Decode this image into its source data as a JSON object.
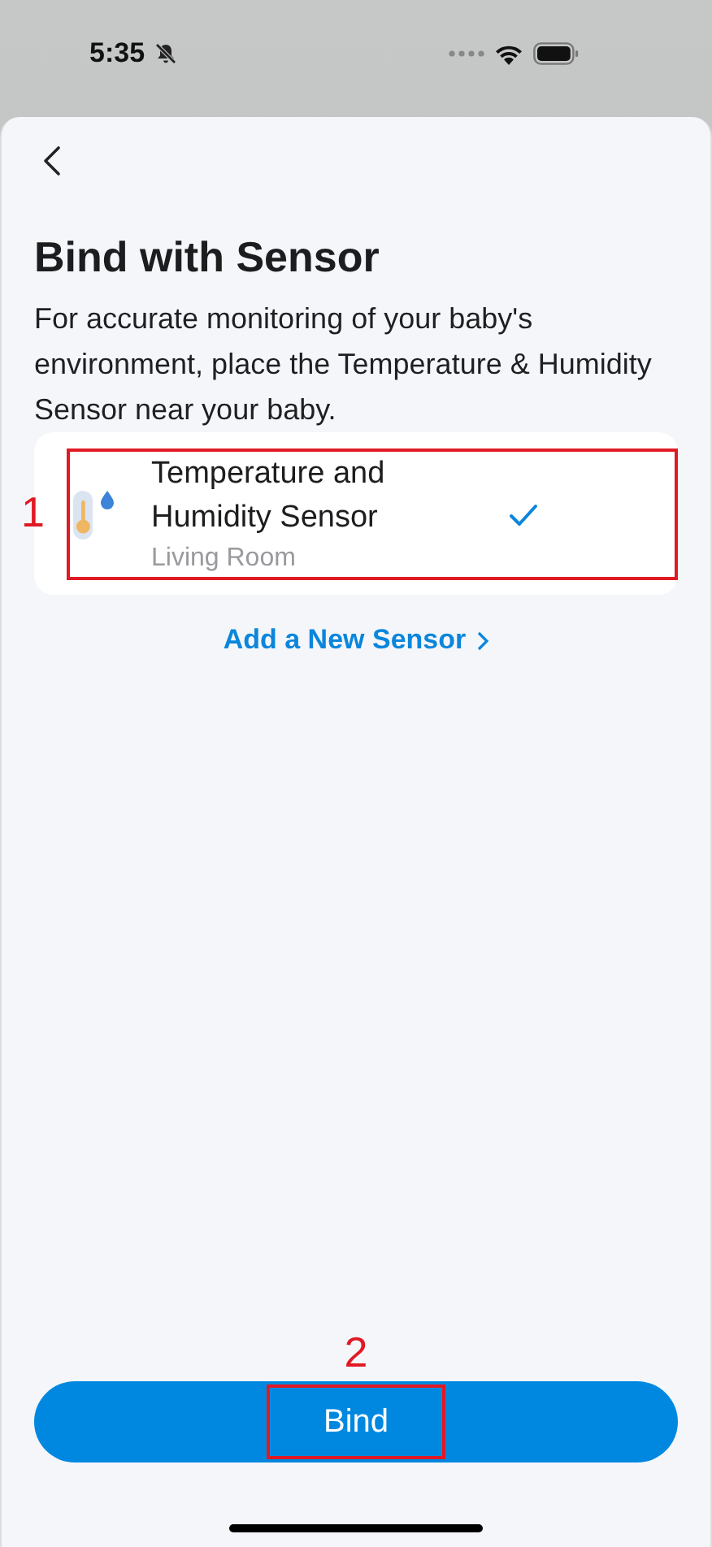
{
  "status_bar": {
    "time": "5:35",
    "silent": true
  },
  "title": "Bind with Sensor",
  "description": "For accurate monitoring of your baby's environment, place the Temperature & Humidity Sensor near your baby.",
  "sensors": [
    {
      "name": "Temperature and Humidity Sensor",
      "room": "Living Room",
      "selected": true,
      "annotation": "1"
    }
  ],
  "add_link": "Add a New Sensor",
  "bind_button": {
    "label": "Bind",
    "annotation": "2"
  }
}
